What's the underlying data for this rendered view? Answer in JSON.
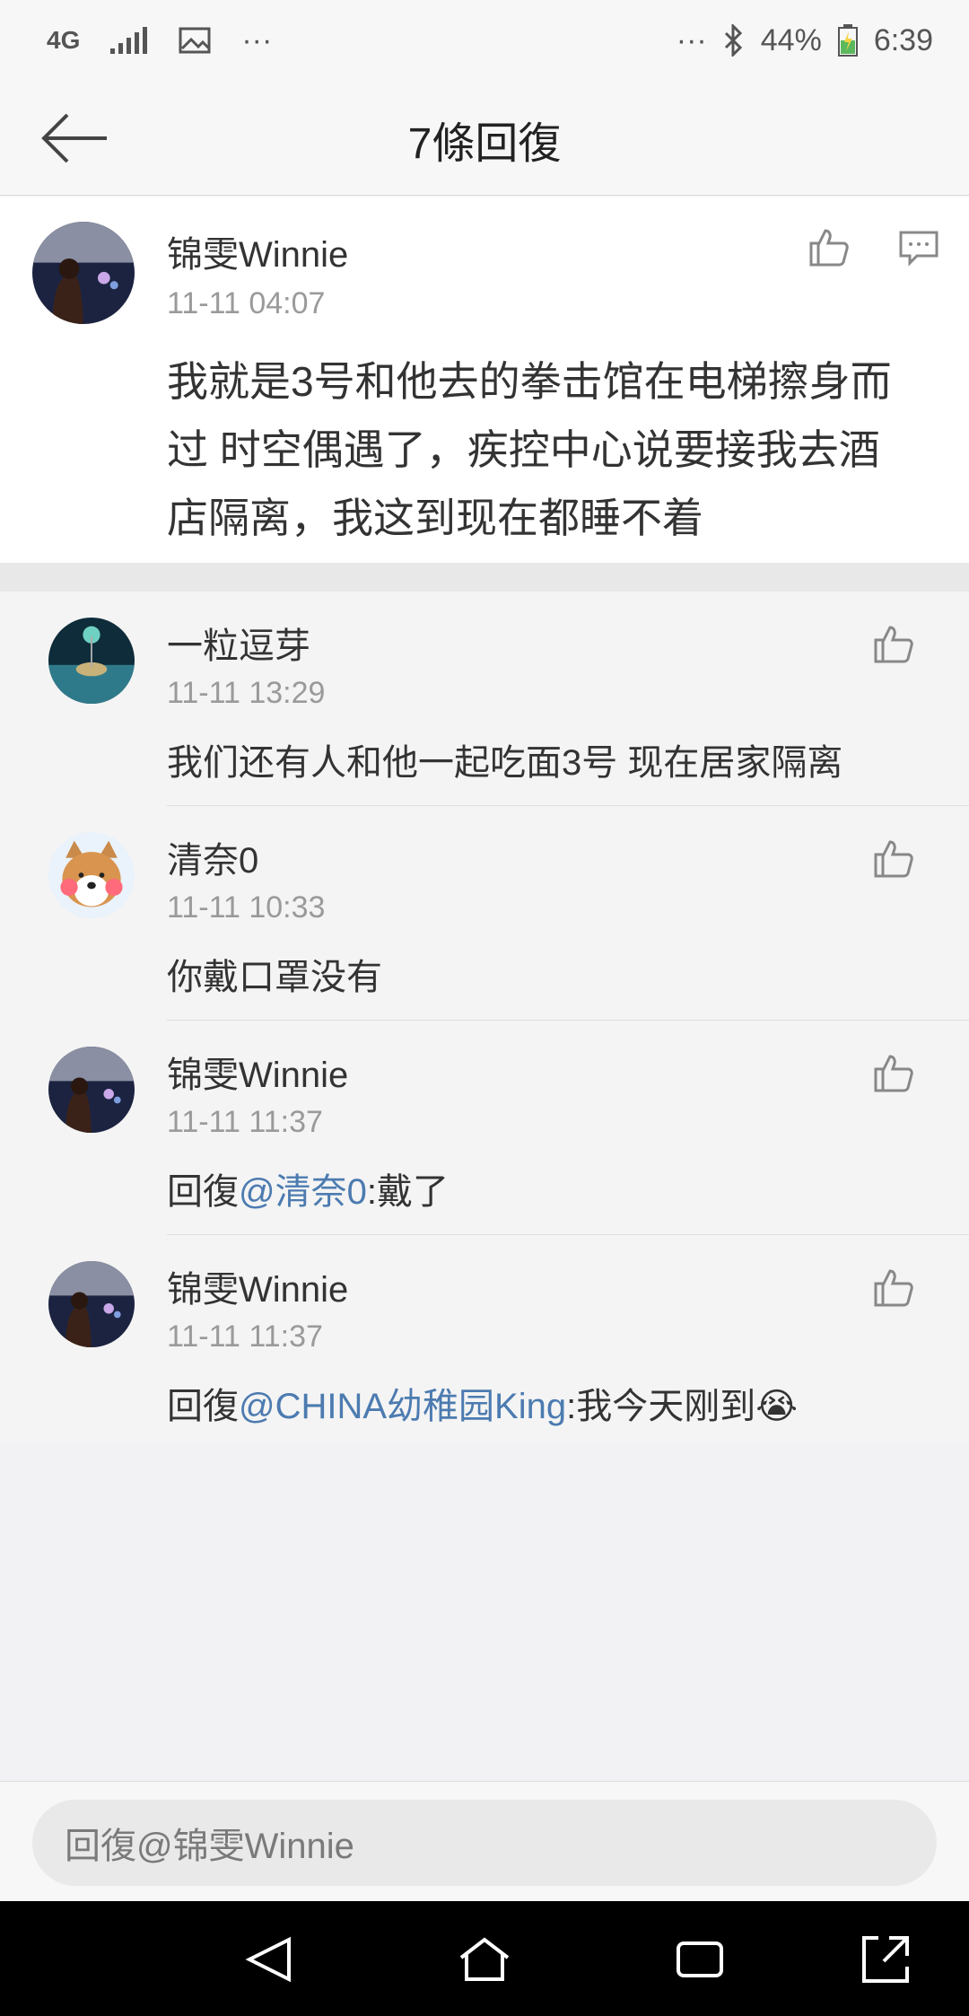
{
  "status_bar": {
    "network": "4G",
    "dots_left": "···",
    "dots_right": "···",
    "battery": "44%",
    "time": "6:39"
  },
  "header": {
    "title": "7條回復"
  },
  "main_comment": {
    "user": "锦雯Winnie",
    "time": "11-11 04:07",
    "text_lines": [
      "我就是3号和他去的拳击馆在电梯擦身而",
      "过 时空偶遇了，疾控中心说要接我去酒",
      "店隔离，我这到现在都睡不着"
    ]
  },
  "replies": [
    {
      "user": "一粒逗芽",
      "time": "11-11 13:29",
      "prefix": "",
      "mention": "",
      "text": "我们还有人和他一起吃面3号  现在居家隔离"
    },
    {
      "user": "清奈0",
      "time": "11-11 10:33",
      "prefix": "",
      "mention": "",
      "text": "你戴口罩没有"
    },
    {
      "user": "锦雯Winnie",
      "time": "11-11 11:37",
      "prefix": "回復",
      "mention": "@清奈0",
      "text": ":戴了"
    },
    {
      "user": "锦雯Winnie",
      "time": "11-11 11:37",
      "prefix": "回復",
      "mention": "@CHINA幼稚园King",
      "text": ":我今天刚到😭"
    }
  ],
  "input": {
    "placeholder": "回復@锦雯Winnie"
  },
  "colors": {
    "link": "#4c7bb0",
    "meta": "#9a9a9a"
  }
}
